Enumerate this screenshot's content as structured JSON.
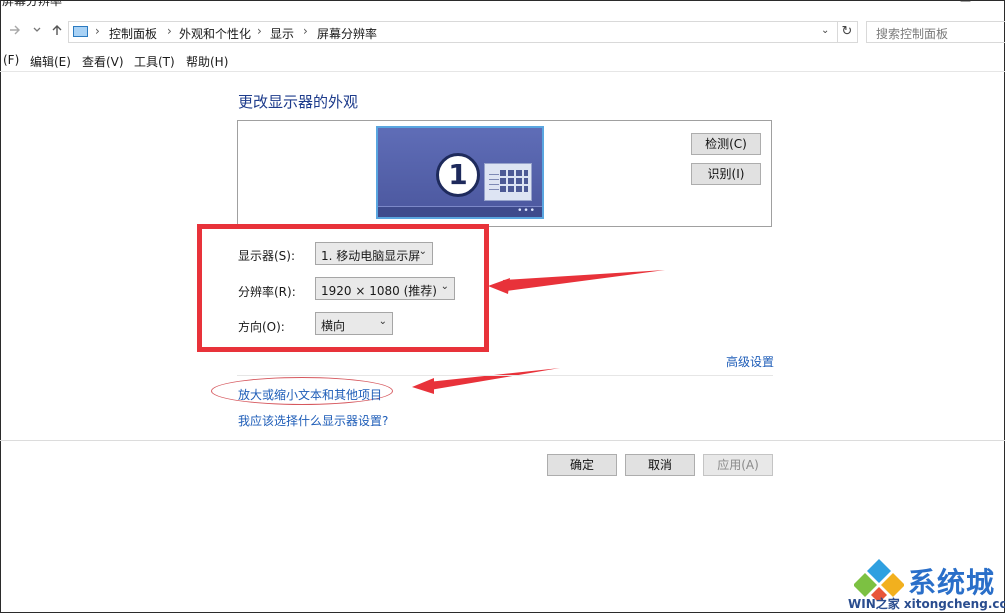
{
  "window": {
    "title": "屏幕分辨率",
    "minimize_glyph": "—"
  },
  "nav": {
    "forward_icon": "arrow-right-icon",
    "dropdown_icon": "chevron-down-icon",
    "up_icon": "arrow-up-icon"
  },
  "breadcrumb": [
    "控制面板",
    "外观和个性化",
    "显示",
    "屏幕分辨率"
  ],
  "breadcrumb_separator": "›",
  "address_dropdown": "⌄",
  "refresh_glyph": "↻",
  "search": {
    "placeholder": "搜索控制面板"
  },
  "menu": [
    {
      "label": "(F)"
    },
    {
      "label": "编辑(E)"
    },
    {
      "label": "查看(V)"
    },
    {
      "label": "工具(T)"
    },
    {
      "label": "帮助(H)"
    }
  ],
  "page": {
    "heading": "更改显示器的外观",
    "monitor_number": "1",
    "detect_button": "检测(C)",
    "identify_button": "识别(I)",
    "display_label": "显示器(S):",
    "display_value": "1. 移动电脑显示屏",
    "resolution_label": "分辨率(R):",
    "resolution_value": "1920 × 1080 (推荐)",
    "orientation_label": "方向(O):",
    "orientation_value": "横向",
    "advanced_link": "高级设置",
    "text_size_link": "放大或缩小文本和其他项目",
    "help_link": "我应该选择什么显示器设置?"
  },
  "footer": {
    "ok": "确定",
    "cancel": "取消",
    "apply": "应用(A)"
  },
  "watermark": {
    "brand": "系统城",
    "url": "WIN之家 xitongcheng.com"
  },
  "colors": {
    "annotation_red": "#e8323a",
    "link_blue": "#1e5db8",
    "heading_blue": "#1e3c8c"
  }
}
